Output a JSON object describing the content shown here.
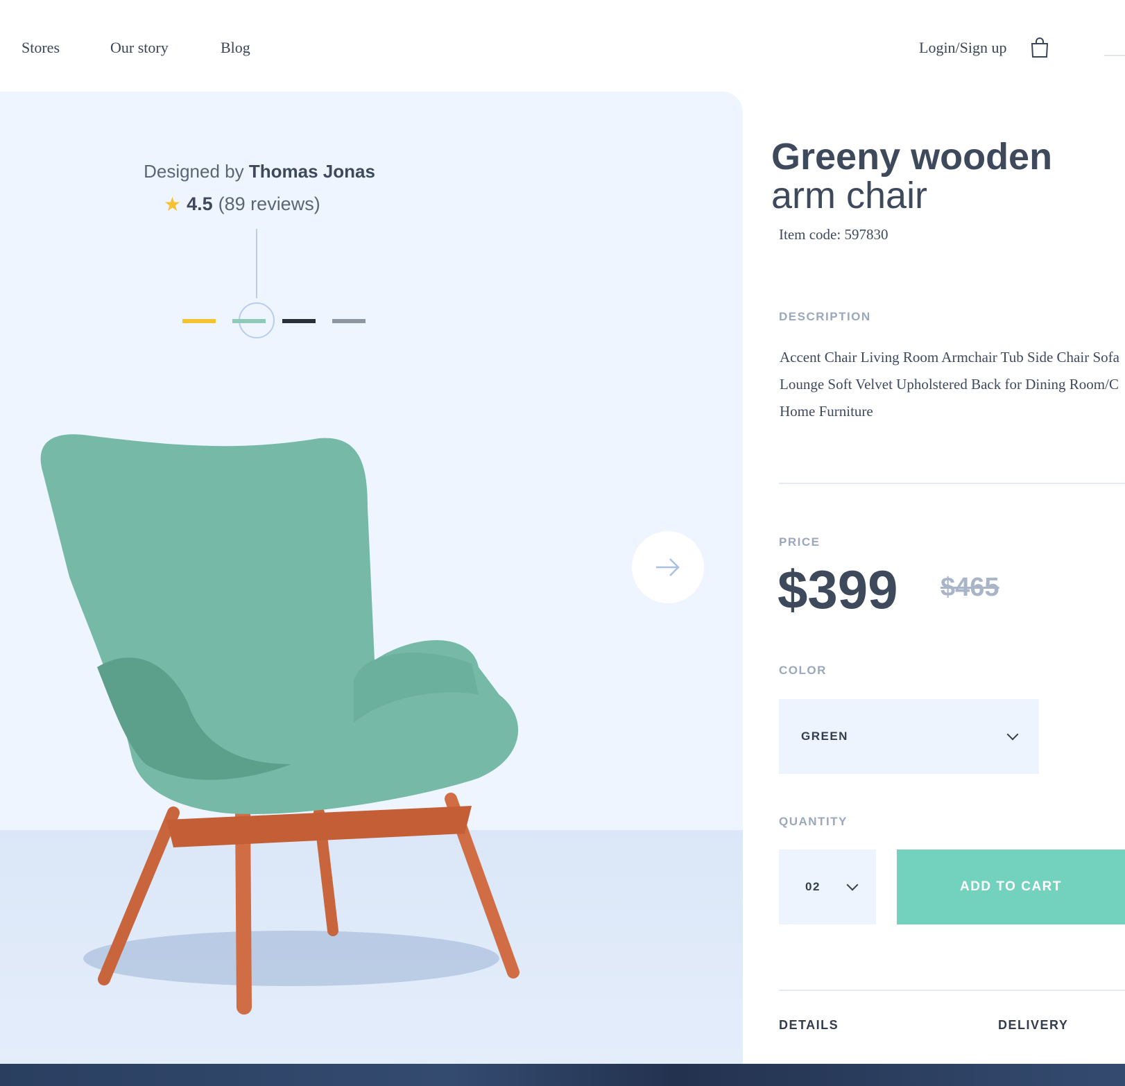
{
  "nav": {
    "links": [
      "Stores",
      "Our story",
      "Blog"
    ],
    "login": "Login/Sign up",
    "cart_icon": "shopping-bag-icon"
  },
  "hero": {
    "designed_by": "Designed by",
    "designer": "Thomas Jonas",
    "rating": "4.5",
    "reviews": "(89 reviews)",
    "swatches": [
      "#f5c232",
      "#8fc9b8",
      "#2b2f36",
      "#8d96a3"
    ],
    "selected_swatch": 1,
    "next_icon": "arrow-right-icon"
  },
  "product": {
    "title_line1": "Greeny wooden",
    "title_line2": "arm chair",
    "item_code": "Item code: 597830",
    "description_label": "DESCRIPTION",
    "description_lines": [
      "Accent Chair Living Room Armchair Tub Side Chair Sofa",
      "Lounge Soft Velvet Upholstered Back for Dining Room/C",
      "Home Furniture"
    ],
    "price_label": "PRICE",
    "price": "$399",
    "old_price": "$465",
    "color_label": "COLOR",
    "color_value": "GREEN",
    "quantity_label": "QUANTITY",
    "quantity_value": "02",
    "add_to_cart": "ADD TO CART",
    "tabs": [
      "DETAILS",
      "DELIVERY"
    ]
  },
  "colors": {
    "accent": "#73d2bd",
    "text": "#3e4a5c",
    "muted": "#9aa7bd",
    "panel": "#eef5fe",
    "footer": "#344b70"
  }
}
